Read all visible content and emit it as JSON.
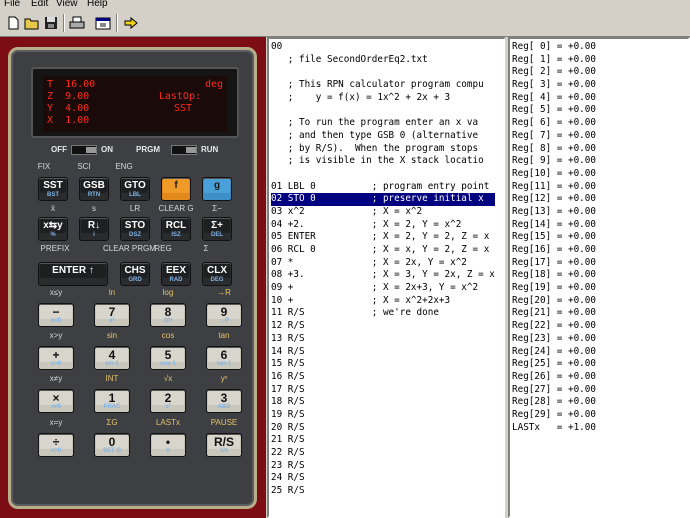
{
  "menu": [
    "File",
    "Edit",
    "View",
    "Help"
  ],
  "toolbar": [
    "new-icon",
    "open-icon",
    "save-icon",
    "print-icon",
    "properties-icon",
    "run-icon"
  ],
  "display": {
    "rows": [
      {
        "label": "T",
        "value": "16.00",
        "right": "deg"
      },
      {
        "label": "Z",
        "value": "9.00",
        "right": "LastOp:"
      },
      {
        "label": "Y",
        "value": "4.00",
        "right": "SST"
      },
      {
        "label": "X",
        "value": "1.00",
        "right": ""
      }
    ]
  },
  "switches": {
    "off": "OFF",
    "on": "ON",
    "prgm": "PRGM",
    "run": "RUN"
  },
  "keypad": {
    "row1_labels": [
      "FIX",
      "SCI",
      "ENG"
    ],
    "row1": [
      {
        "top": "SST",
        "bottom": "BST",
        "style": "dark"
      },
      {
        "top": "GSB",
        "bottom": "RTN",
        "style": "dark"
      },
      {
        "top": "GTO",
        "bottom": "LBL",
        "style": "dark"
      },
      {
        "top": "f",
        "bottom": "",
        "style": "orange"
      },
      {
        "top": "g",
        "bottom": "",
        "style": "blue"
      }
    ],
    "row2_labels": [
      "x̄",
      "s",
      "LR",
      "CLEAR G",
      "Σ−"
    ],
    "row2": [
      {
        "top": "x⇆y",
        "bottom": "%",
        "style": "dark"
      },
      {
        "top": "R↓",
        "bottom": "i",
        "style": "dark"
      },
      {
        "top": "STO",
        "bottom": "DSZ",
        "style": "dark"
      },
      {
        "top": "RCL",
        "bottom": "ISZ",
        "style": "dark"
      },
      {
        "top": "Σ+",
        "bottom": "DEL",
        "style": "dark"
      }
    ],
    "row3_labels": [
      "PREFIX",
      "CLEAR PRGM",
      "REG",
      "Σ"
    ],
    "row3": [
      {
        "top": "ENTER ↑",
        "bottom": "",
        "style": "dark",
        "wide": true
      },
      {
        "top": "CHS",
        "bottom": "GRD",
        "style": "dark"
      },
      {
        "top": "EEX",
        "bottom": "RAD",
        "style": "dark"
      },
      {
        "top": "CLX",
        "bottom": "DEG",
        "style": "dark"
      }
    ],
    "row4_labels": [
      "x≤y",
      "ln",
      "log",
      "→R"
    ],
    "row4": [
      {
        "top": "−",
        "bottom": "x<0",
        "style": "light"
      },
      {
        "top": "7",
        "bottom": "eˣ",
        "style": "light"
      },
      {
        "top": "8",
        "bottom": "10ˣ",
        "style": "light"
      },
      {
        "top": "9",
        "bottom": "→P",
        "style": "light"
      }
    ],
    "row5_labels": [
      "x>y",
      "sin",
      "cos",
      "tan"
    ],
    "row5": [
      {
        "top": "+",
        "bottom": "x>0",
        "style": "light"
      },
      {
        "top": "4",
        "bottom": "sin-1",
        "style": "light"
      },
      {
        "top": "5",
        "bottom": "cos-1",
        "style": "light"
      },
      {
        "top": "6",
        "bottom": "tan-1",
        "style": "light"
      }
    ],
    "row6_labels": [
      "x≠y",
      "INT",
      "√x",
      "yˣ"
    ],
    "row6": [
      {
        "top": "×",
        "bottom": "x≠0",
        "style": "light"
      },
      {
        "top": "1",
        "bottom": "FRAC",
        "style": "light"
      },
      {
        "top": "2",
        "bottom": "x²",
        "style": "light"
      },
      {
        "top": "3",
        "bottom": "ABS",
        "style": "light"
      }
    ],
    "row7_labels": [
      "x=y",
      "ΣG",
      "LASTx",
      "PAUSE"
    ],
    "row7": [
      {
        "top": "÷",
        "bottom": "x=0",
        "style": "light"
      },
      {
        "top": "0",
        "bottom": "SET G",
        "style": "light"
      },
      {
        "top": "•",
        "bottom": "π",
        "style": "light"
      },
      {
        "top": "R/S",
        "bottom": "1/x",
        "style": "light"
      }
    ]
  },
  "program": {
    "lines": [
      "00",
      "   ; file SecondOrderEq2.txt",
      "",
      "   ; This RPN calculator program compu",
      "   ;    y = f(x) = 1x^2 + 2x + 3",
      "",
      "   ; To run the program enter an x va",
      "   ; and then type GSB 0 (alternative",
      "   ; by R/S).  When the program stops",
      "   ; is visible in the X stack locatio",
      "",
      "01 LBL 0          ; program entry point",
      "02 STO 0          ; preserve initial x",
      "03 x^2            ; X = x^2",
      "04 +2.            ; X = 2, Y = x^2",
      "05 ENTER          ; X = 2, Y = 2, Z = x",
      "06 RCL 0          ; X = x, Y = 2, Z = x",
      "07 *              ; X = 2x, Y = x^2",
      "08 +3.            ; X = 3, Y = 2x, Z = x",
      "09 +              ; X = 2x+3, Y = x^2",
      "10 +              ; X = x^2+2x+3",
      "11 R/S            ; we're done",
      "12 R/S",
      "13 R/S",
      "14 R/S",
      "15 R/S",
      "16 R/S",
      "17 R/S",
      "18 R/S",
      "19 R/S",
      "20 R/S",
      "21 R/S",
      "22 R/S",
      "23 R/S",
      "24 R/S",
      "25 R/S"
    ],
    "selected_index": 12
  },
  "registers": [
    "Reg[ 0] = +0.00",
    "Reg[ 1] = +0.00",
    "Reg[ 2] = +0.00",
    "Reg[ 3] = +0.00",
    "Reg[ 4] = +0.00",
    "Reg[ 5] = +0.00",
    "Reg[ 6] = +0.00",
    "Reg[ 7] = +0.00",
    "Reg[ 8] = +0.00",
    "Reg[ 9] = +0.00",
    "Reg[10] = +0.00",
    "Reg[11] = +0.00",
    "Reg[12] = +0.00",
    "Reg[13] = +0.00",
    "Reg[14] = +0.00",
    "Reg[15] = +0.00",
    "Reg[16] = +0.00",
    "Reg[17] = +0.00",
    "Reg[18] = +0.00",
    "Reg[19] = +0.00",
    "Reg[20] = +0.00",
    "Reg[21] = +0.00",
    "Reg[22] = +0.00",
    "Reg[23] = +0.00",
    "Reg[24] = +0.00",
    "Reg[25] = +0.00",
    "Reg[26] = +0.00",
    "Reg[27] = +0.00",
    "Reg[28] = +0.00",
    "Reg[29] = +0.00",
    "LASTx   = +1.00"
  ]
}
